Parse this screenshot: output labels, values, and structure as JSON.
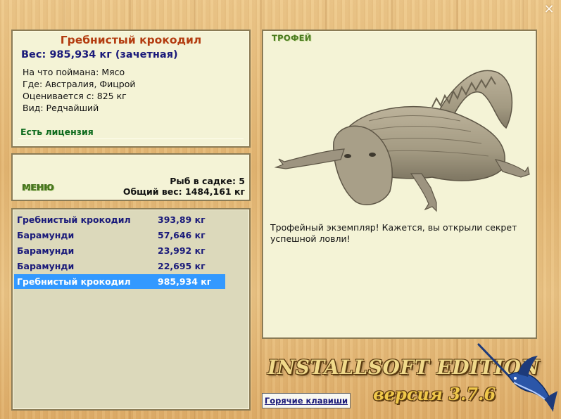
{
  "info": {
    "fish_name": "Гребнистый крокодил",
    "weight_line": "Вес: 985,934 кг (зачетная)",
    "details": [
      "На что поймана: Мясо",
      "Где: Австралия, Фицрой",
      "Оценивается с: 825 кг",
      "Вид: Редчайший"
    ],
    "license": "Есть лицензия"
  },
  "menu": {
    "menu_label": "МЕНЮ",
    "fish_in_net": "Рыб в садке: 5",
    "total_weight": "Общий вес: 1484,161 кг"
  },
  "catch_list": [
    {
      "name": "Гребнистый крокодил",
      "weight": "393,89 кг",
      "selected": false
    },
    {
      "name": "Барамунди",
      "weight": "57,646 кг",
      "selected": false
    },
    {
      "name": "Барамунди",
      "weight": "23,992 кг",
      "selected": false
    },
    {
      "name": "Барамунди",
      "weight": "22,695 кг",
      "selected": false
    },
    {
      "name": "Гребнистый крокодил",
      "weight": "985,934 кг",
      "selected": true
    }
  ],
  "trophy": {
    "label": "ТРОФЕЙ",
    "image": "crocodile-trophy-image",
    "message": "Трофейный экземпляр! Кажется, вы открыли секрет успешной ловли!"
  },
  "footer": {
    "hotkeys_label": "Горячие клавиши",
    "logo_text": "INSTALLSOFT EDITION",
    "version_text": "версия 3.7.6",
    "logo_icon": "marlin-icon"
  },
  "window": {
    "close_icon": "close-icon"
  },
  "colors": {
    "fish_title": "#b33c10",
    "dark_blue_text": "#1a1a7a",
    "green_label": "#4a7a1e",
    "license_green": "#0e6b1e",
    "selection": "#3399ff",
    "panel_bg": "#f4f3d6",
    "list_bg": "#dcd9bb"
  }
}
